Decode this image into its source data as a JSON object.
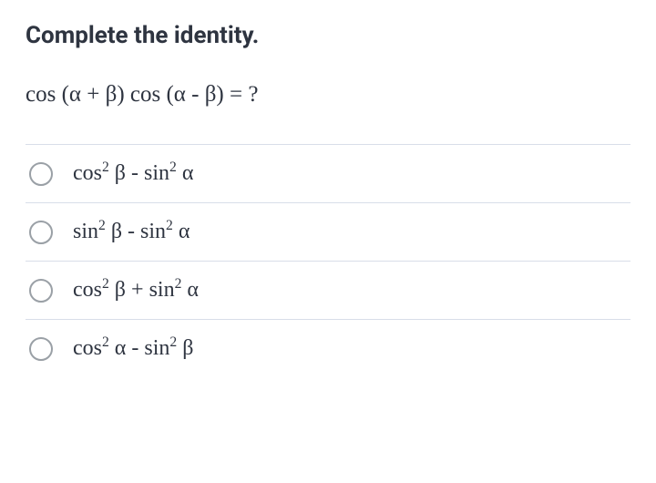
{
  "question": {
    "title": "Complete the identity.",
    "equation": "cos (α + β) cos (α - β) = ?"
  },
  "options": [
    {
      "fn1": "cos",
      "var1": "β",
      "op": " - ",
      "fn2": "sin",
      "var2": "α"
    },
    {
      "fn1": "sin",
      "var1": "β",
      "op": " - ",
      "fn2": "sin",
      "var2": "α"
    },
    {
      "fn1": "cos",
      "var1": "β",
      "op": " + ",
      "fn2": "sin",
      "var2": "α"
    },
    {
      "fn1": "cos",
      "var1": "α",
      "op": " - ",
      "fn2": "sin",
      "var2": "β"
    }
  ],
  "chart_data": {
    "type": "table",
    "title": "Multiple choice options for trigonometric identity",
    "options_plain": [
      "cos² β - sin² α",
      "sin² β - sin² α",
      "cos² β + sin² α",
      "cos² α - sin² β"
    ]
  }
}
